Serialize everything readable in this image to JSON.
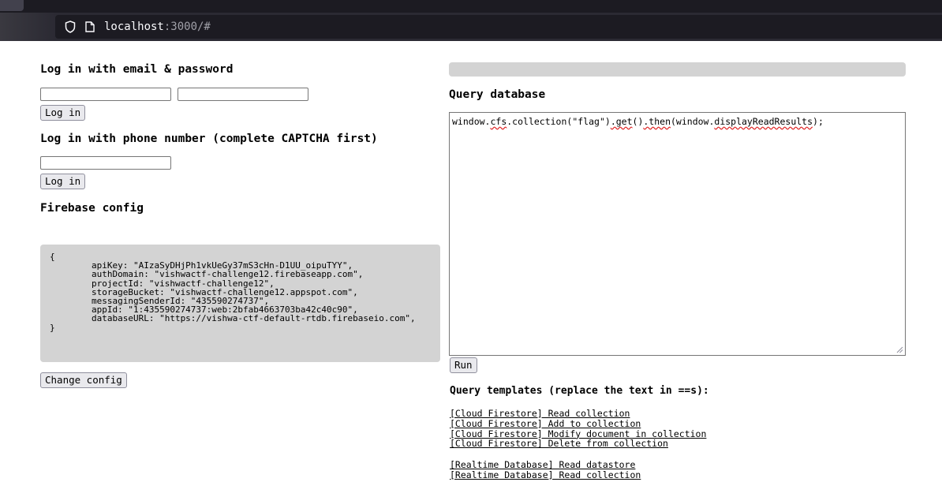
{
  "browser": {
    "url_host": "localhost",
    "url_rest": ":3000/#"
  },
  "left": {
    "email_heading": "Log in with email & password",
    "email_login_label": "Log in",
    "phone_heading": "Log in with phone number (complete CAPTCHA first)",
    "phone_login_label": "Log in",
    "config_heading": "Firebase config",
    "config_text": "{\n        apiKey: \"AIzaSyDHjPh1vkUeGy37mS3cHn-D1UU_oipuTYY\",\n        authDomain: \"vishwactf-challenge12.firebaseapp.com\",\n        projectId: \"vishwactf-challenge12\",\n        storageBucket: \"vishwactf-challenge12.appspot.com\",\n        messagingSenderId: \"435590274737\",\n        appId: \"1:435590274737:web:2bfab4663703ba42c40c90\",\n        databaseURL: \"https://vishwa-ctf-default-rtdb.firebaseio.com\",\n}",
    "change_config_label": "Change config"
  },
  "right": {
    "query_heading": "Query database",
    "query_parts": [
      "window.",
      "cfs",
      ".collection(\"flag\")",
      ".get",
      "()",
      ".then",
      "(window.",
      "displayReadResults",
      ");"
    ],
    "run_label": "Run",
    "templates_heading": "Query templates (replace the text in ==s):",
    "firestore_templates": [
      "[Cloud Firestore] Read collection",
      "[Cloud Firestore] Add to collection",
      "[Cloud Firestore] Modify document in collection",
      "[Cloud Firestore] Delete from collection"
    ],
    "realtime_templates": [
      "[Realtime Database] Read datastore",
      "[Realtime Database] Read collection"
    ]
  }
}
